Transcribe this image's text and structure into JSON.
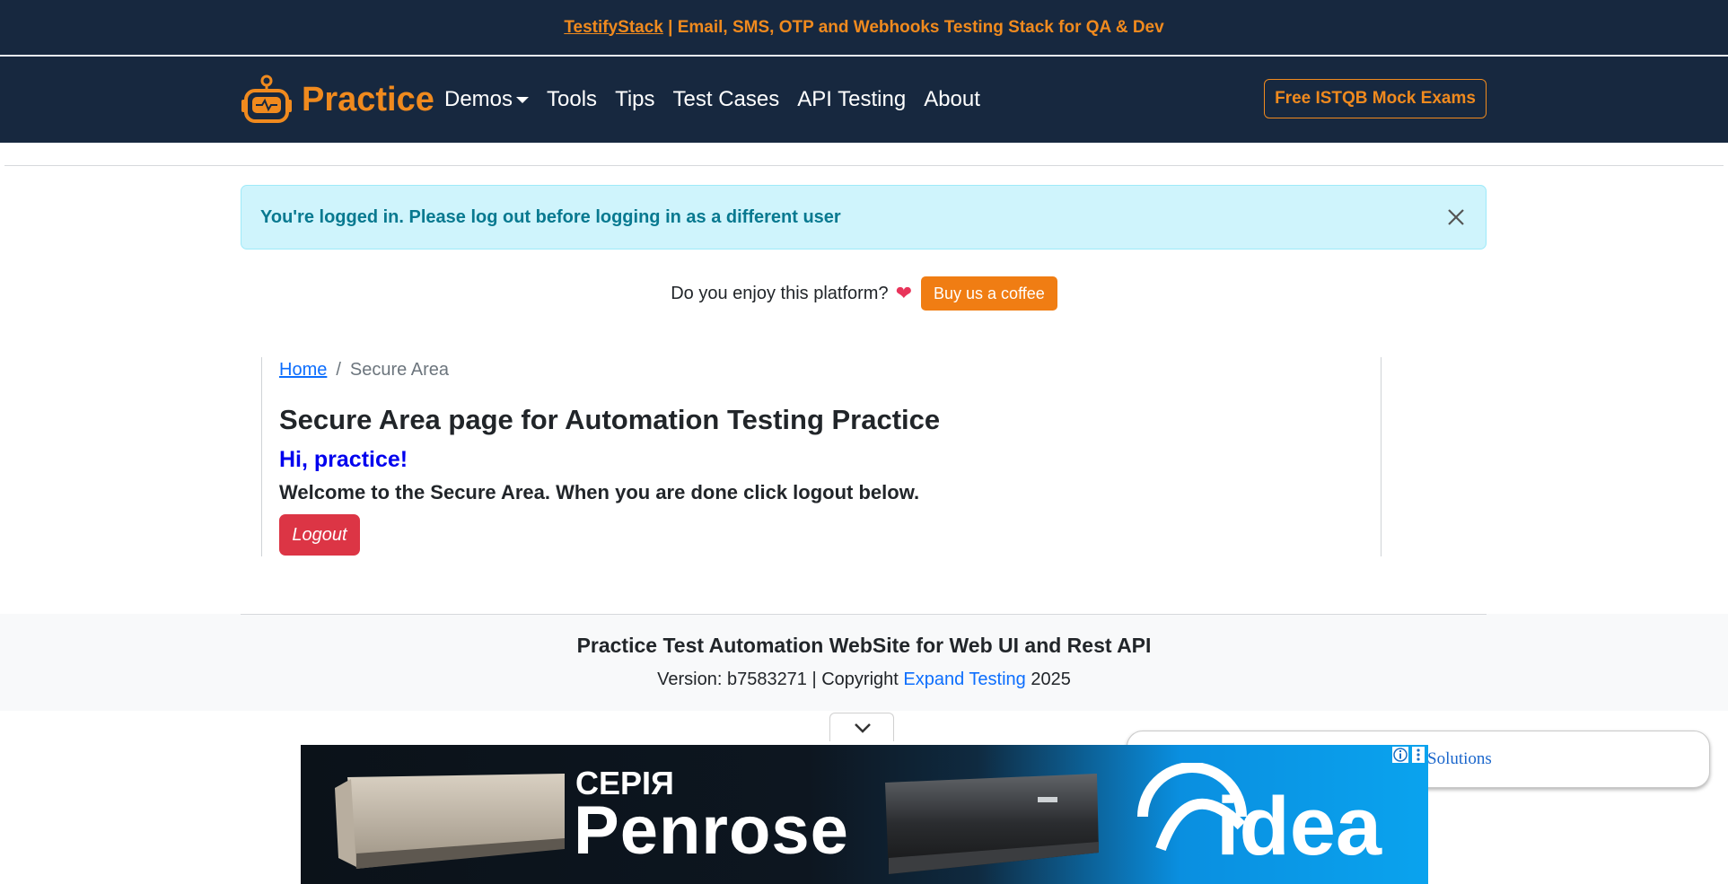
{
  "topbar": {
    "brand_link": "TestifyStack",
    "tagline": " | Email, SMS, OTP and Webhooks Testing Stack for QA & Dev"
  },
  "navbar": {
    "brand": "Practice",
    "items": [
      "Demos",
      "Tools",
      "Tips",
      "Test Cases",
      "API Testing",
      "About"
    ],
    "cta": "Free ISTQB Mock Exams"
  },
  "alert": {
    "message": "You're logged in. Please log out before logging in as a different user"
  },
  "support": {
    "question": "Do you enjoy this platform?",
    "button": "Buy us a coffee"
  },
  "breadcrumb": {
    "home": "Home",
    "separator": "/",
    "current": "Secure Area"
  },
  "main": {
    "title": "Secure Area page for Automation Testing Practice",
    "greeting": "Hi, practice!",
    "welcome": "Welcome to the Secure Area. When you are done click logout below.",
    "logout": "Logout"
  },
  "footer": {
    "title": "Practice Test Automation WebSite for Web UI and Rest API",
    "version_prefix": "Version: b7583271 | Copyright ",
    "company": "Expand Testing",
    "year": " 2025"
  },
  "side_card": {
    "text": "Solutions"
  },
  "ad": {
    "series": "СЕРІЯ",
    "model": "Penrose",
    "brand": "Midea"
  },
  "colors": {
    "navy": "#17283f",
    "orange": "#f08a1e",
    "alert_bg": "#cff4fc",
    "alert_text": "#087990",
    "logout": "#dc3545"
  }
}
